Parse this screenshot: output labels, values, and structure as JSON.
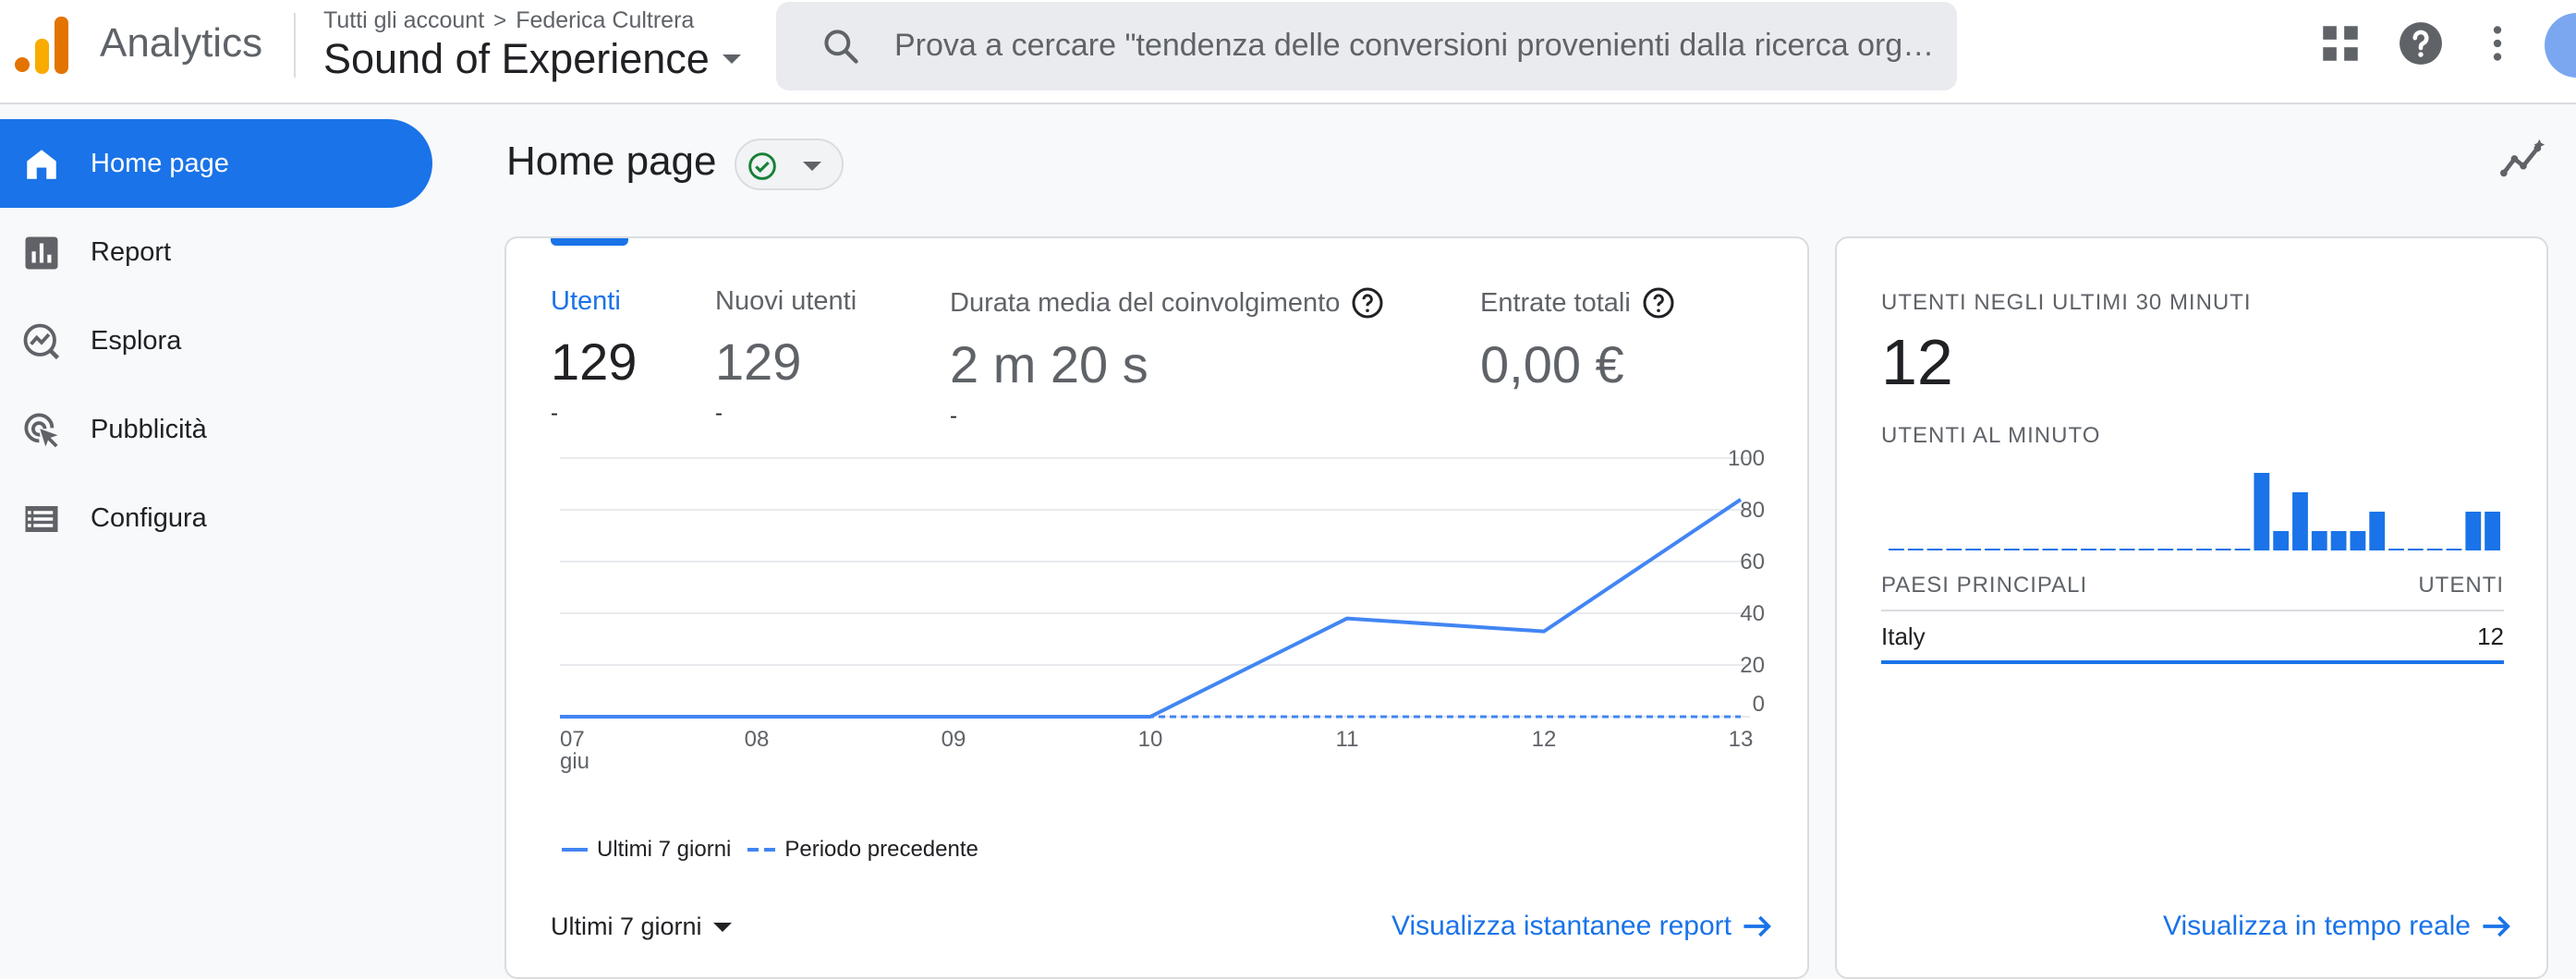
{
  "app": {
    "name": "Analytics"
  },
  "breadcrumb": {
    "account": "Tutti gli account",
    "separator": ">",
    "user": "Federica Cultrera"
  },
  "property": {
    "name": "Sound of Experience"
  },
  "search": {
    "placeholder": "Prova a cercare \"tendenza delle conversioni provenienti dalla ricerca organica\""
  },
  "topbar_icons": [
    "apps-icon",
    "help-icon",
    "more-vert-icon",
    "avatar"
  ],
  "sidebar": {
    "items": [
      {
        "label": "Home page",
        "icon": "home-icon",
        "active": true
      },
      {
        "label": "Report",
        "icon": "bar-chart-icon",
        "active": false
      },
      {
        "label": "Esplora",
        "icon": "explore-icon",
        "active": false
      },
      {
        "label": "Pubblicità",
        "icon": "ads-click-icon",
        "active": false
      },
      {
        "label": "Configura",
        "icon": "list-icon",
        "active": false
      }
    ]
  },
  "page": {
    "title": "Home page"
  },
  "colors": {
    "accent": "#1a73e8",
    "line": "#4285f4",
    "status": "#188038"
  },
  "metrics": [
    {
      "label": "Utenti",
      "value": "129",
      "delta": "-",
      "selected": true
    },
    {
      "label": "Nuovi utenti",
      "value": "129",
      "delta": "-"
    },
    {
      "label": "Durata media del coinvolgimento",
      "value": "2 m 20 s",
      "delta": "-",
      "help": true
    },
    {
      "label": "Entrate totali",
      "value": "0,00 €",
      "help": true
    }
  ],
  "chart_data": {
    "type": "line",
    "categories": [
      "07",
      "08",
      "09",
      "10",
      "11",
      "12",
      "13"
    ],
    "x_sublabel": "giu",
    "series": [
      {
        "name": "Ultimi 7 giorni",
        "values": [
          0,
          0,
          0,
          0,
          38,
          33,
          84
        ],
        "style": "solid"
      },
      {
        "name": "Periodo precedente",
        "values": [
          0,
          0,
          0,
          0,
          0,
          0,
          0
        ],
        "style": "dashed"
      }
    ],
    "yticks": [
      0,
      20,
      40,
      60,
      80,
      100
    ],
    "ylim": [
      0,
      100
    ],
    "grid": true,
    "legend": "bottom-left"
  },
  "date_range": {
    "label": "Ultimi 7 giorni"
  },
  "main_cta": {
    "label": "Visualizza istantanee report"
  },
  "realtime": {
    "title": "UTENTI NEGLI ULTIMI 30 MINUTI",
    "count": "12",
    "per_minute_label": "UTENTI AL MINUTO",
    "per_minute_values": [
      0,
      0,
      0,
      0,
      0,
      0,
      0,
      0,
      0,
      0,
      0,
      0,
      0,
      0,
      0,
      0,
      0,
      0,
      0,
      4,
      1,
      3,
      1,
      1,
      1,
      2,
      0,
      0,
      0,
      0,
      2,
      2
    ],
    "table_header": {
      "dimension": "PAESI PRINCIPALI",
      "metric": "UTENTI"
    },
    "rows": [
      {
        "country": "Italy",
        "users": "12"
      }
    ],
    "cta": "Visualizza in tempo reale"
  }
}
